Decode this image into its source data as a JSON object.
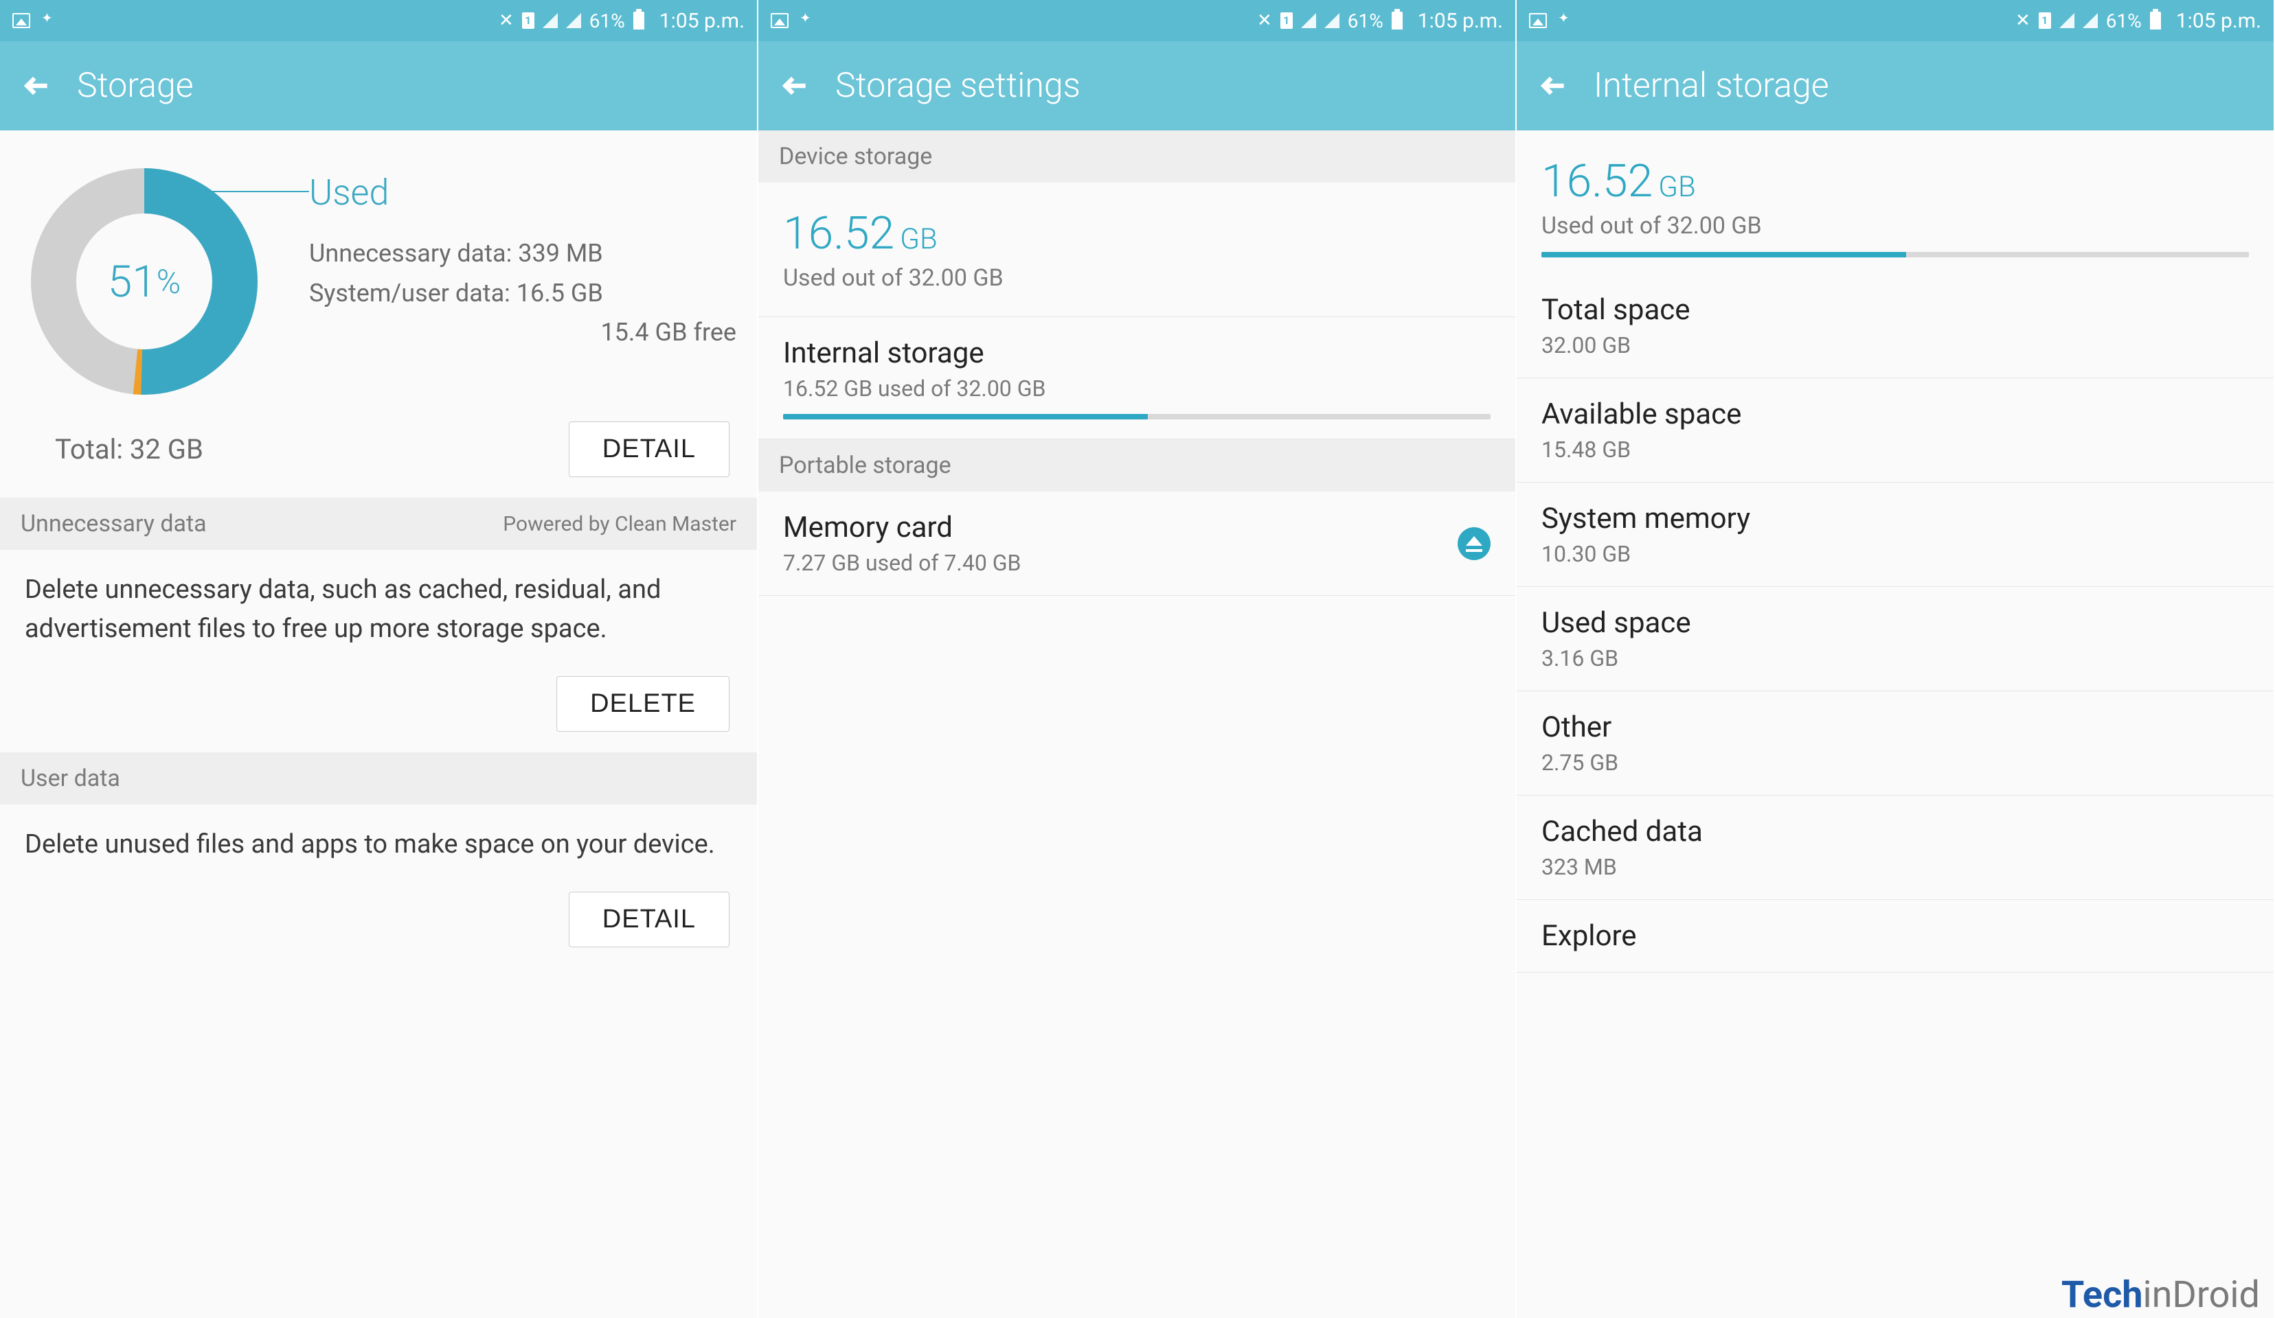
{
  "status": {
    "battery": "61%",
    "time": "1:05 p.m.",
    "sim": "1"
  },
  "screen1": {
    "title": "Storage",
    "used_label": "Used",
    "percent": "51",
    "percent_suffix": "%",
    "line1": "Unnecessary data: 339 MB",
    "line2": "System/user data: 16.5 GB",
    "line3": "15.4 GB free",
    "total": "Total: 32 GB",
    "detail_btn": "DETAIL",
    "sec1_header": "Unnecessary data",
    "sec1_right": "Powered by Clean Master",
    "sec1_body": "Delete unnecessary data, such as cached, residual, and advertisement files to free up more storage space.",
    "sec1_btn": "DELETE",
    "sec2_header": "User data",
    "sec2_body": "Delete unused files and apps to make space on your device.",
    "sec2_btn": "DETAIL"
  },
  "screen2": {
    "title": "Storage settings",
    "section_device": "Device storage",
    "used_value": "16.52",
    "used_unit": "GB",
    "used_sub": "Used out of 32.00 GB",
    "internal_title": "Internal storage",
    "internal_sub": "16.52 GB used of 32.00 GB",
    "internal_pct": 51.6,
    "section_portable": "Portable storage",
    "memory_title": "Memory card",
    "memory_sub": "7.27 GB used of 7.40 GB"
  },
  "screen3": {
    "title": "Internal storage",
    "used_value": "16.52",
    "used_unit": "GB",
    "used_sub": "Used out of 32.00 GB",
    "progress_pct": 51.6,
    "items": [
      {
        "title": "Total space",
        "sub": "32.00 GB"
      },
      {
        "title": "Available space",
        "sub": "15.48 GB"
      },
      {
        "title": "System memory",
        "sub": "10.30 GB"
      },
      {
        "title": "Used space",
        "sub": "3.16 GB"
      },
      {
        "title": "Other",
        "sub": "2.75 GB"
      },
      {
        "title": "Cached data",
        "sub": "323 MB"
      },
      {
        "title": "Explore",
        "sub": ""
      }
    ]
  },
  "watermark": {
    "t": "Tech",
    "in": "in",
    "d": "Droid"
  },
  "chart_data": {
    "type": "pie",
    "title": "Storage usage",
    "categories": [
      "Used (system/user data)",
      "Unnecessary data",
      "Free"
    ],
    "values": [
      16.5,
      0.339,
      15.4
    ],
    "unit": "GB",
    "total": 32,
    "percent_used": 51,
    "colors": [
      "#3aa8c2",
      "#f0a028",
      "#d0d0d0"
    ]
  }
}
